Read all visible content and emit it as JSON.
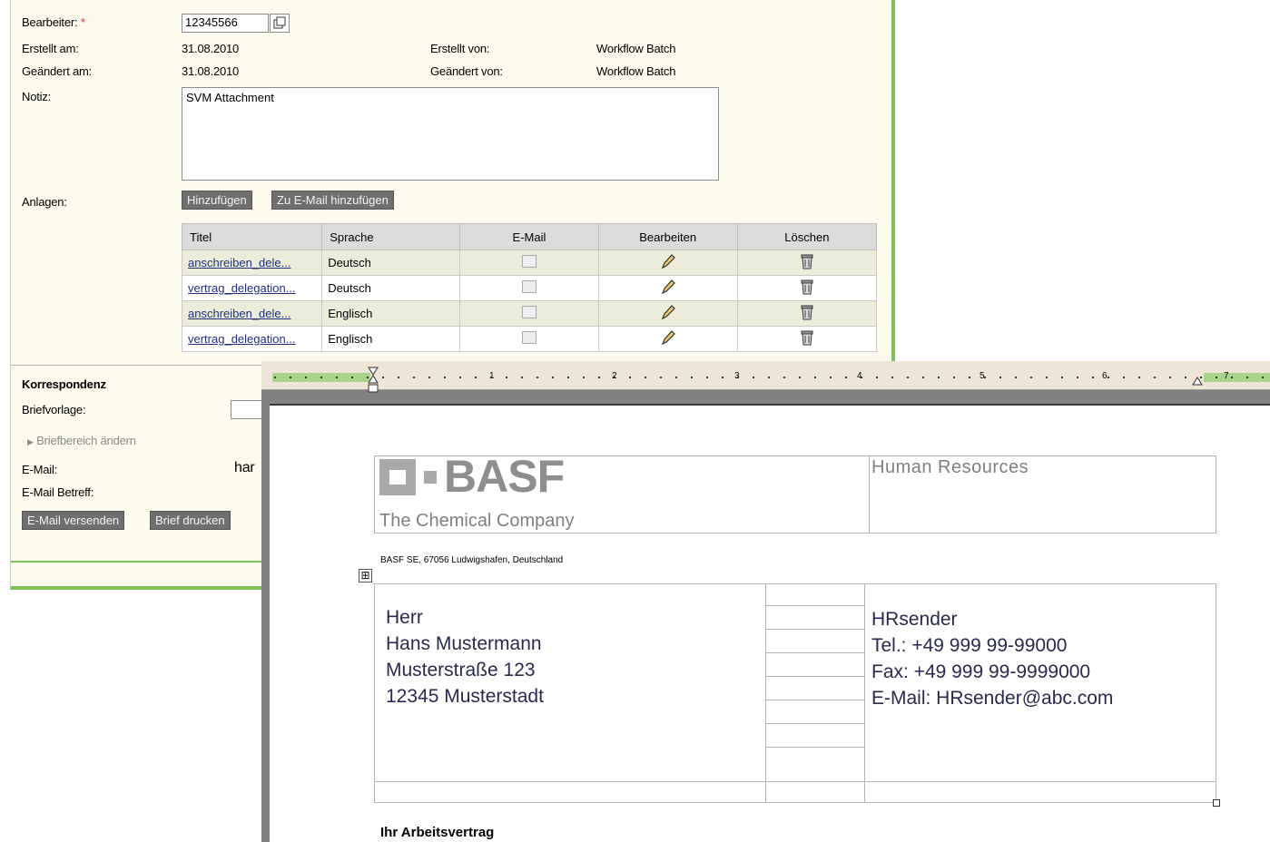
{
  "form": {
    "bearbeiter_label": "Bearbeiter:",
    "required_mark": "*",
    "bearbeiter_value": "12345566",
    "erstellt_am_label": "Erstellt am:",
    "erstellt_am_value": "31.08.2010",
    "erstellt_von_label": "Erstellt von:",
    "erstellt_von_value": "Workflow Batch",
    "geaendert_am_label": "Geändert am:",
    "geaendert_am_value": "31.08.2010",
    "geaendert_von_label": "Geändert von:",
    "geaendert_von_value": "Workflow Batch",
    "notiz_label": "Notiz:",
    "notiz_value": "SVM Attachment",
    "anlagen_label": "Anlagen:",
    "hinzufuegen_button": "Hinzufügen",
    "zu_email_button": "Zu E-Mail hinzufügen"
  },
  "attachments": {
    "headers": [
      "Titel",
      "Sprache",
      "E-Mail",
      "Bearbeiten",
      "Löschen"
    ],
    "rows": [
      {
        "titel": "anschreiben_dele...",
        "sprache": "Deutsch"
      },
      {
        "titel": "vertrag_delegation...",
        "sprache": "Deutsch"
      },
      {
        "titel": "anschreiben_dele...",
        "sprache": "Englisch"
      },
      {
        "titel": "vertrag_delegation...",
        "sprache": "Englisch"
      }
    ]
  },
  "korrespondenz": {
    "heading": "Korrespondenz",
    "briefvorlage_label": "Briefvorlage:",
    "briefbereich_link": "Briefbereich ändern",
    "email_label": "E-Mail:",
    "email_value_partial": "har",
    "email_betreff_label": "E-Mail Betreff:",
    "email_versenden_button": "E-Mail versenden",
    "brief_drucken_button": "Brief drucken"
  },
  "ruler": {
    "numbers": [
      "1",
      "2",
      "3",
      "4",
      "5",
      "6",
      "7"
    ]
  },
  "letter": {
    "logo_text": "BASF",
    "tagline": "The Chemical Company",
    "department": "Human Resources",
    "sender_line": "BASF SE, 67056 Ludwigshafen, Deutschland",
    "recipient": [
      "Herr",
      "Hans Mustermann",
      "Musterstraße 123",
      "12345 Musterstadt"
    ],
    "contact": [
      "HRsender",
      "Tel.: +49 999 99-99000",
      "Fax: +49 999 99-9999000",
      "E-Mail: HRsender@abc.com"
    ],
    "subject": "Ihr Arbeitsvertrag"
  },
  "colors": {
    "form_bg": "#fdfbee",
    "accent_green": "#7cc15a",
    "button_gray": "#6f6f6f"
  }
}
